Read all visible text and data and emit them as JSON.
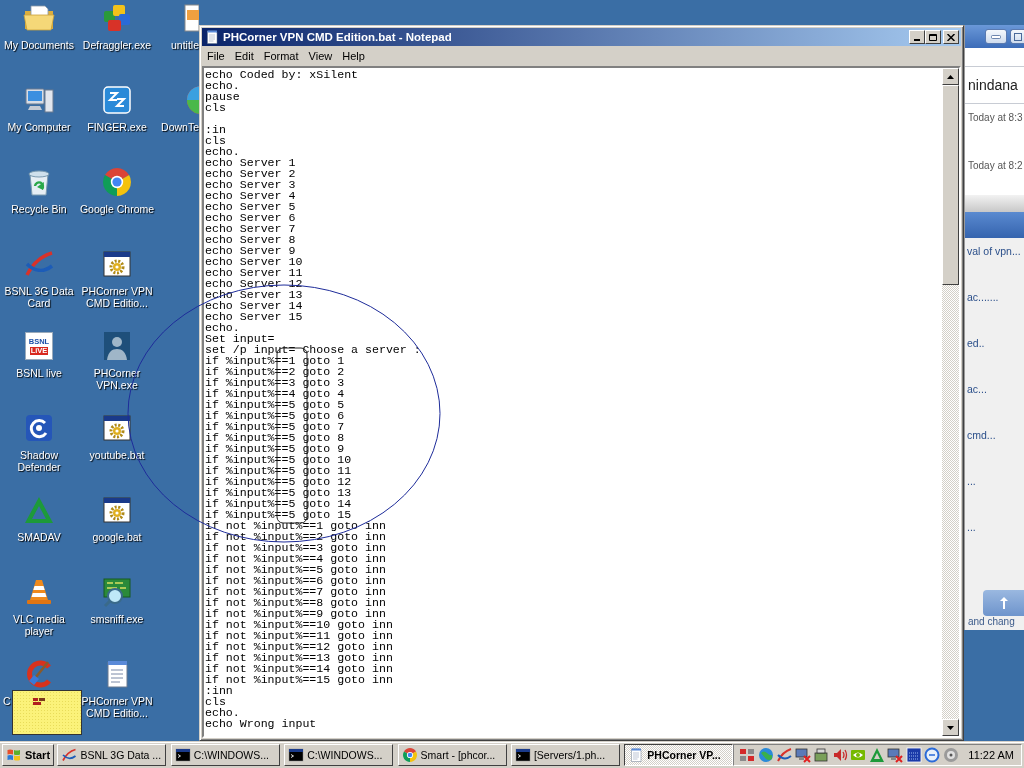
{
  "desktop": {
    "icons": [
      {
        "label": "My Documents",
        "kind": "documents"
      },
      {
        "label": "My Computer",
        "kind": "computer"
      },
      {
        "label": "Recycle Bin",
        "kind": "recycle"
      },
      {
        "label": "BSNL 3G Data Card",
        "kind": "swoosh"
      },
      {
        "label": "BSNL live",
        "kind": "logo",
        "logo_lines": [
          "BSNL",
          "LiVE"
        ]
      },
      {
        "label": "Shadow Defender",
        "kind": "shield"
      },
      {
        "label": "SMADAV",
        "kind": "triangle"
      },
      {
        "label": "VLC media player",
        "kind": "cone"
      },
      {
        "label": "C",
        "kind": "brush"
      },
      {
        "label": "Defraggler.exe",
        "kind": "cubes"
      },
      {
        "label": "FINGER.exe",
        "kind": "finger"
      },
      {
        "label": "Google Chrome",
        "kind": "chrome"
      },
      {
        "label": "PHCorner VPN CMD Editio...",
        "kind": "batch"
      },
      {
        "label": "PHCorner VPN.exe",
        "kind": "portrait"
      },
      {
        "label": "youtube.bat",
        "kind": "batch"
      },
      {
        "label": "google.bat",
        "kind": "batch"
      },
      {
        "label": "smsniff.exe",
        "kind": "sniffer"
      },
      {
        "label": "PHCorner VPN CMD Editio...",
        "kind": "notepad"
      },
      {
        "label": "untitle",
        "kind": "file"
      },
      {
        "label": "DownTe",
        "kind": "ball"
      }
    ]
  },
  "notepad": {
    "title": "PHCorner VPN CMD Edition.bat - Notepad",
    "menu": [
      "File",
      "Edit",
      "Format",
      "View",
      "Help"
    ],
    "text": "echo Coded by: xSilent\necho.\npause\ncls\n\n:in\ncls\necho.\necho Server 1\necho Server 2\necho Server 3\necho Server 4\necho Server 5\necho Server 6\necho Server 7\necho Server 8\necho Server 9\necho Server 10\necho Server 11\necho Server 12\necho Server 13\necho Server 14\necho Server 15\necho.\nSet input=\nset /p input= Choose a server :\nif %input%==1 goto 1\nif %input%==2 goto 2\nif %input%==3 goto 3\nif %input%==4 goto 4\nif %input%==5 goto 5\nif %input%==5 goto 6\nif %input%==5 goto 7\nif %input%==5 goto 8\nif %input%==5 goto 9\nif %input%==5 goto 10\nif %input%==5 goto 11\nif %input%==5 goto 12\nif %input%==5 goto 13\nif %input%==5 goto 14\nif %input%==5 goto 15\nif not %input%==1 goto inn\nif not %input%==2 goto inn\nif not %input%==3 goto inn\nif not %input%==4 goto inn\nif not %input%==5 goto inn\nif not %input%==6 goto inn\nif not %input%==7 goto inn\nif not %input%==8 goto inn\nif not %input%==9 goto inn\nif not %input%==10 goto inn\nif not %input%==11 goto inn\nif not %input%==12 goto inn\nif not %input%==13 goto inn\nif not %input%==14 goto inn\nif not %input%==15 goto inn\n:inn\ncls\necho.\necho Wrong input"
  },
  "background_window": {
    "heading": "nindana",
    "times": [
      "Today at 8:3",
      "Today at 8:2"
    ],
    "links": [
      "val of vpn...",
      "ac.......",
      "ed..",
      "ac...",
      "cmd...",
      "...",
      "..."
    ],
    "footer": "and chang"
  },
  "taskbar": {
    "start": "Start",
    "tasks": [
      {
        "label": "BSNL 3G Data ...",
        "kind": "swoosh",
        "selected": false
      },
      {
        "label": "C:\\WINDOWS...",
        "kind": "console",
        "selected": false
      },
      {
        "label": "C:\\WINDOWS...",
        "kind": "console",
        "selected": false
      },
      {
        "label": "Smart - [phcor...",
        "kind": "chrome",
        "selected": false
      },
      {
        "label": "[Servers/1.ph...",
        "kind": "console",
        "selected": false
      },
      {
        "label": "PHCorner VP...",
        "kind": "notepad",
        "selected": true
      }
    ],
    "clock": "11:22 AM"
  }
}
